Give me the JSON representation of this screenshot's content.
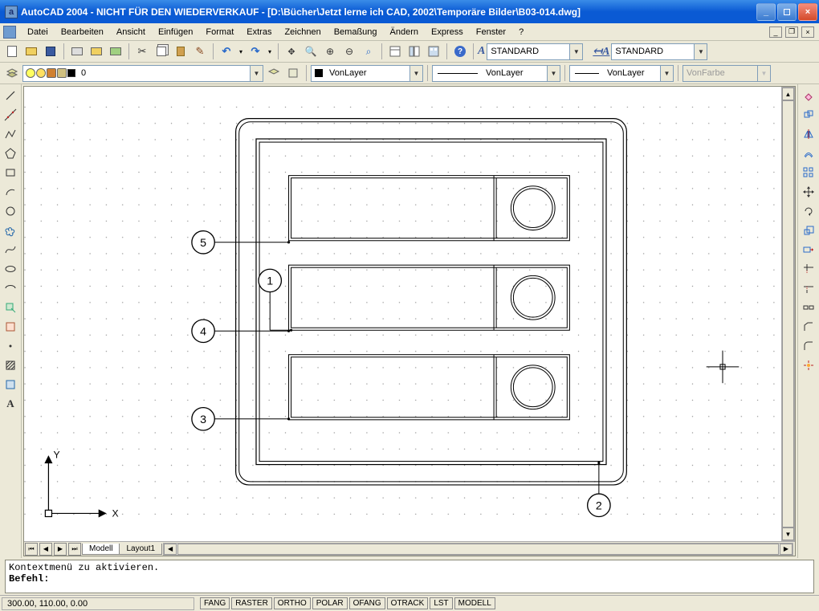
{
  "title": "AutoCAD 2004 - NICHT FÜR DEN WIEDERVERKAUF - [D:\\Bücher\\Jetzt lerne ich CAD, 2002\\Temporäre Bilder\\B03-014.dwg]",
  "app_icon_label": "a",
  "menus": [
    "Datei",
    "Bearbeiten",
    "Ansicht",
    "Einfügen",
    "Format",
    "Extras",
    "Zeichnen",
    "Bemaßung",
    "Ändern",
    "Express",
    "Fenster",
    "?"
  ],
  "toolbar1": {
    "style1": "STANDARD",
    "style2": "STANDARD"
  },
  "toolbar2": {
    "layer": "0",
    "linetype_label": "VonLayer",
    "lineweight_label": "VonLayer",
    "plotstyle_label": "VonLayer",
    "color_label": "VonFarbe"
  },
  "tabs": {
    "model": "Modell",
    "layout1": "Layout1"
  },
  "axis": {
    "x": "X",
    "y": "Y"
  },
  "callouts": {
    "c1": "1",
    "c2": "2",
    "c3": "3",
    "c4": "4",
    "c5": "5"
  },
  "cmd": {
    "l1": "Kontextmenü zu aktivieren.",
    "l2": "Befehl:"
  },
  "status": {
    "coords": "300.00, 110.00, 0.00",
    "toggles": [
      "FANG",
      "RASTER",
      "ORTHO",
      "POLAR",
      "OFANG",
      "OTRACK",
      "LST",
      "MODELL"
    ]
  }
}
